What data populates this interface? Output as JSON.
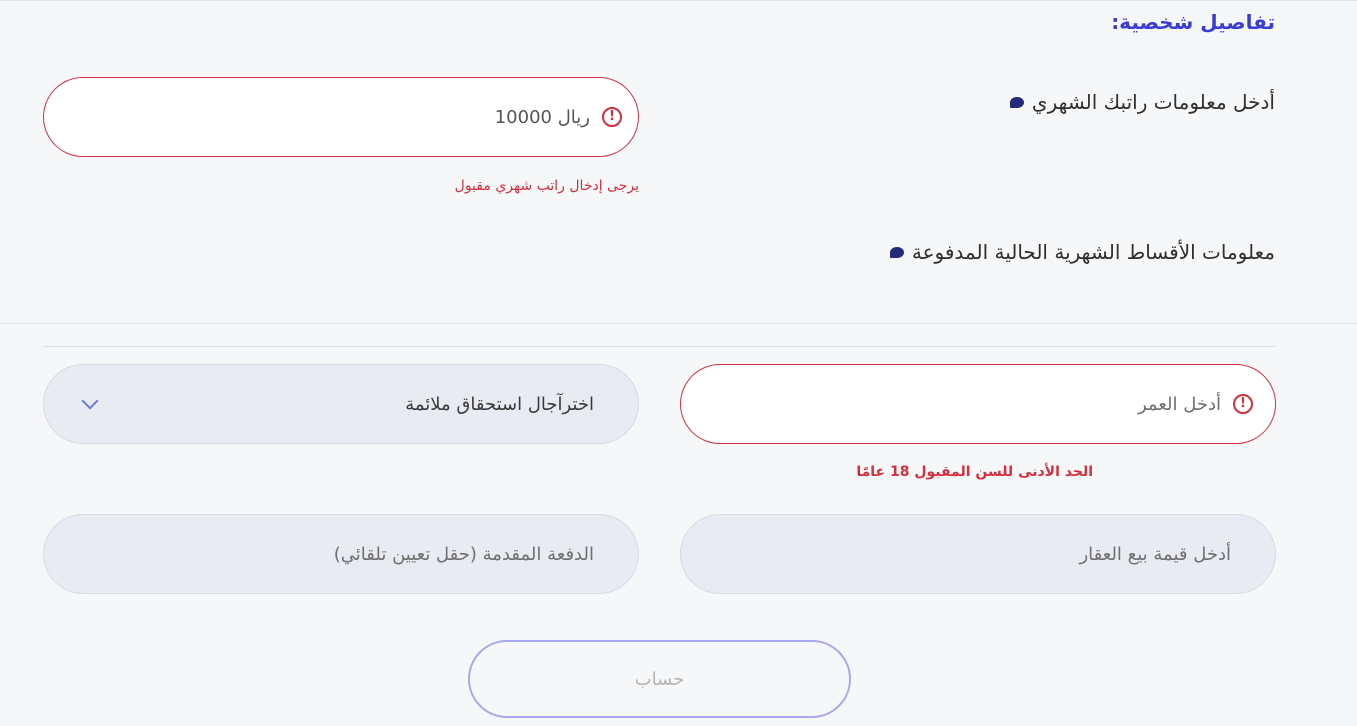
{
  "section": {
    "title": "تفاصيل شخصية:"
  },
  "salary": {
    "label": "أدخل معلومات راتبك الشهري",
    "value": "ريال 10000",
    "error": "يرجى إدخال راتب شهري مقبول"
  },
  "installments": {
    "label": "معلومات الأقساط الشهرية الحالية المدفوعة"
  },
  "age": {
    "placeholder": "أدخل العمر",
    "error": "الحد الأدنى للسن المقبول 18 عامًا"
  },
  "eligibility": {
    "placeholder": "اخترآجال استحقاق ملائمة"
  },
  "property": {
    "placeholder": "أدخل قيمة بيع العقار"
  },
  "down_payment": {
    "placeholder": "الدفعة المقدمة (حقل تعيين تلقائي)"
  },
  "calculate": {
    "label": "حساب"
  },
  "colors": {
    "accent": "#3b3bd6",
    "error": "#d32f3c",
    "button_border": "#a8a8ee"
  }
}
